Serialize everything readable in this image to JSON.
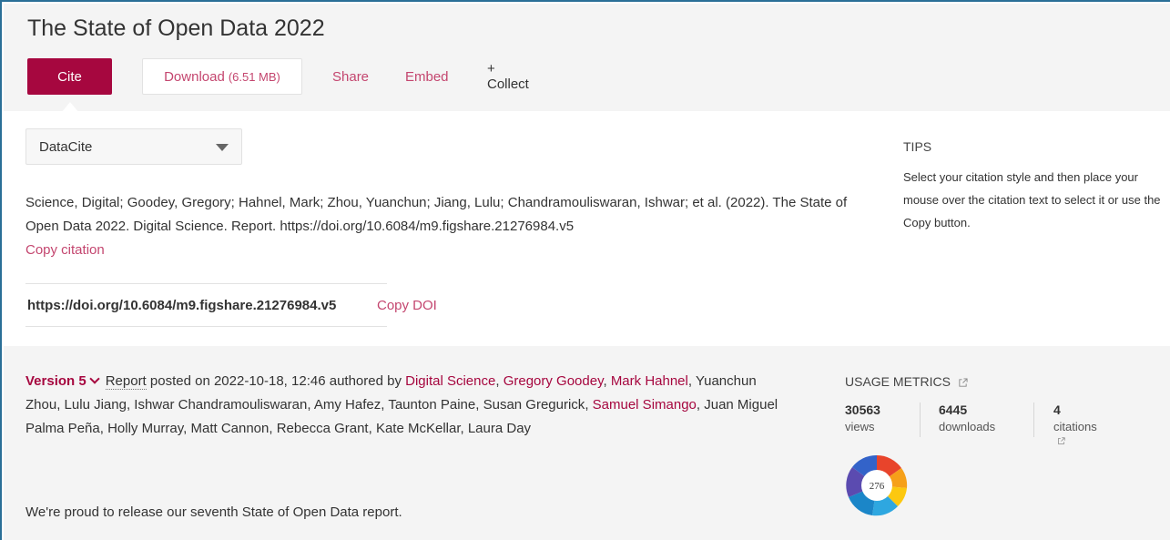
{
  "header": {
    "title": "The State of Open Data 2022"
  },
  "toolbar": {
    "cite_label": "Cite",
    "download_label": "Download",
    "download_size": "(6.51 MB)",
    "share_label": "Share",
    "embed_label": "Embed",
    "collect_label": "+ Collect"
  },
  "cite_panel": {
    "style_selected": "DataCite",
    "citation": "Science, Digital; Goodey, Gregory; Hahnel, Mark; Zhou, Yuanchun; Jiang, Lulu; Chandramouliswaran, Ishwar; et al. (2022). The State of Open Data 2022. Digital Science. Report. https://doi.org/10.6084/m9.figshare.21276984.v5",
    "copy_citation_label": "Copy citation",
    "doi": "https://doi.org/10.6084/m9.figshare.21276984.v5",
    "copy_doi_label": "Copy DOI",
    "tips_title": "TIPS",
    "tips_body": "Select your citation style and then place your mouse over the citation text to select it or use the Copy button."
  },
  "item_meta": {
    "version_label": "Version 5",
    "item_type": "Report",
    "posted_text": " posted on 2022-10-18, 12:46 authored by ",
    "authors": [
      {
        "name": "Digital Science",
        "link": true
      },
      {
        "name": "Gregory Goodey",
        "link": true
      },
      {
        "name": "Mark Hahnel",
        "link": true
      },
      {
        "name": "Yuanchun Zhou",
        "link": false
      },
      {
        "name": "Lulu Jiang",
        "link": false
      },
      {
        "name": "Ishwar Chandramouliswaran",
        "link": false
      },
      {
        "name": "Amy Hafez",
        "link": false
      },
      {
        "name": "Taunton Paine",
        "link": false
      },
      {
        "name": "Susan Gregurick",
        "link": false
      },
      {
        "name": "Samuel Simango",
        "link": true
      },
      {
        "name": "Juan Miguel Palma Peña",
        "link": false
      },
      {
        "name": "Holly Murray",
        "link": false
      },
      {
        "name": "Matt Cannon",
        "link": false
      },
      {
        "name": "Rebecca Grant",
        "link": false
      },
      {
        "name": "Kate McKellar",
        "link": false
      },
      {
        "name": "Laura Day",
        "link": false
      }
    ],
    "description": "We're proud to release our seventh State of Open Data report."
  },
  "usage_metrics": {
    "title": "USAGE METRICS",
    "views_value": "30563",
    "views_label": "views",
    "downloads_value": "6445",
    "downloads_label": "downloads",
    "citations_value": "4",
    "citations_label": "citations",
    "altmetric_score": "276"
  },
  "colors": {
    "brand": "#a6073f",
    "link": "#c4466f",
    "panel_bg": "#f4f4f4",
    "frame_border": "#2a6f97"
  }
}
